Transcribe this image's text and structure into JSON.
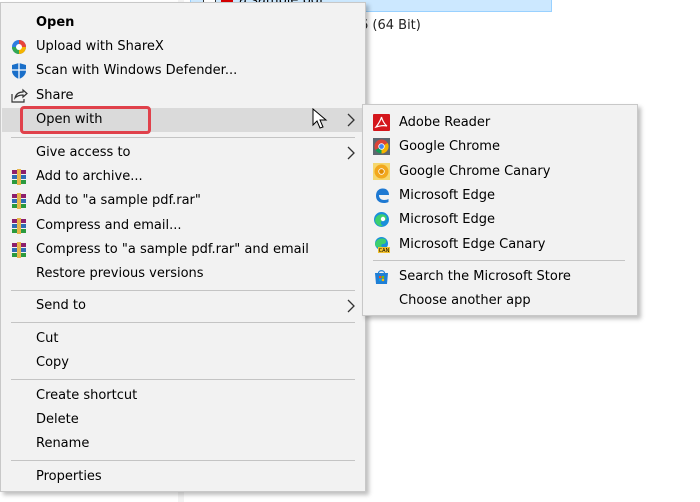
{
  "background": {
    "file_name": "a sample pdf",
    "detail_text": "6 (64 Bit)"
  },
  "context_menu": {
    "items": [
      {
        "label": "Open",
        "icon": "none"
      },
      {
        "label": "Upload with ShareX",
        "icon": "sharex-icon"
      },
      {
        "label": "Scan with Windows Defender...",
        "icon": "defender-shield-icon"
      },
      {
        "label": "Share",
        "icon": "share-icon"
      },
      {
        "label": "Open with",
        "icon": "none",
        "has_submenu": true,
        "highlighted": true
      },
      {
        "label": "Give access to",
        "icon": "none",
        "has_submenu": true
      },
      {
        "label": "Add to archive...",
        "icon": "winrar-icon"
      },
      {
        "label": "Add to \"a sample pdf.rar\"",
        "icon": "winrar-icon"
      },
      {
        "label": "Compress and email...",
        "icon": "winrar-icon"
      },
      {
        "label": "Compress to \"a sample pdf.rar\" and email",
        "icon": "winrar-icon"
      },
      {
        "label": "Restore previous versions",
        "icon": "none"
      },
      {
        "label": "Send to",
        "icon": "none",
        "has_submenu": true
      },
      {
        "label": "Cut",
        "icon": "none"
      },
      {
        "label": "Copy",
        "icon": "none"
      },
      {
        "label": "Create shortcut",
        "icon": "none"
      },
      {
        "label": "Delete",
        "icon": "none"
      },
      {
        "label": "Rename",
        "icon": "none"
      },
      {
        "label": "Properties",
        "icon": "none"
      }
    ]
  },
  "open_with_submenu": {
    "items": [
      {
        "label": "Adobe Reader",
        "icon": "adobe-reader-icon"
      },
      {
        "label": "Google Chrome",
        "icon": "chrome-icon"
      },
      {
        "label": "Google Chrome Canary",
        "icon": "chrome-canary-icon"
      },
      {
        "label": "Microsoft Edge",
        "icon": "edge-legacy-icon"
      },
      {
        "label": "Microsoft Edge",
        "icon": "edge-icon"
      },
      {
        "label": "Microsoft Edge Canary",
        "icon": "edge-canary-icon"
      },
      {
        "label": "Search the Microsoft Store",
        "icon": "microsoft-store-icon"
      },
      {
        "label": "Choose another app",
        "icon": "none"
      }
    ]
  },
  "colors": {
    "menu_bg": "#f2f2f2",
    "highlight": "#dadada",
    "annotation_frame": "#e0414b"
  }
}
